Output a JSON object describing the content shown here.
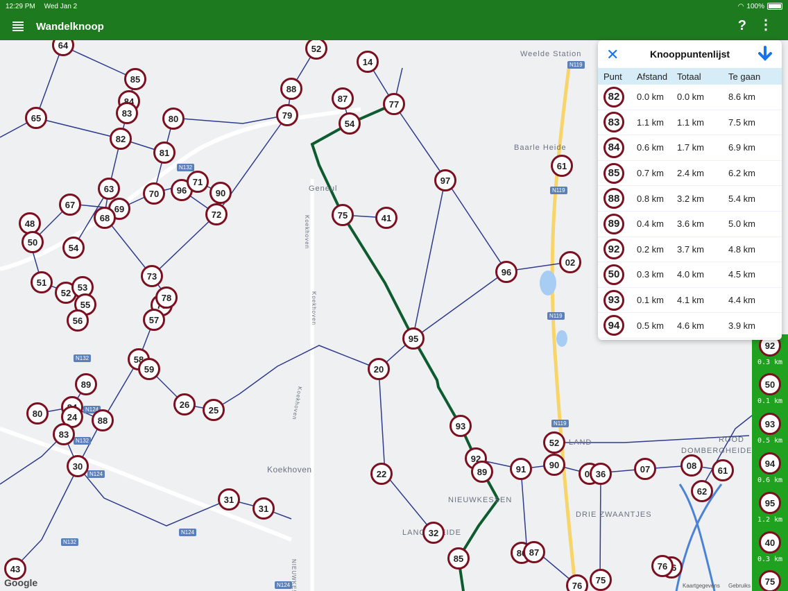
{
  "status": {
    "time": "12:29 PM",
    "date": "Wed Jan 2",
    "battery": "100%"
  },
  "app": {
    "title": "Wandelknoop",
    "help": "?",
    "more": "⋮"
  },
  "panel": {
    "title": "Knooppuntenlijst",
    "columns": [
      "Punt",
      "Afstand",
      "Totaal",
      "Te gaan"
    ],
    "rows": [
      {
        "punt": "82",
        "afstand": "0.0 km",
        "totaal": "0.0 km",
        "te_gaan": "8.6 km"
      },
      {
        "punt": "83",
        "afstand": "1.1 km",
        "totaal": "1.1 km",
        "te_gaan": "7.5 km"
      },
      {
        "punt": "84",
        "afstand": "0.6 km",
        "totaal": "1.7 km",
        "te_gaan": "6.9 km"
      },
      {
        "punt": "85",
        "afstand": "0.7 km",
        "totaal": "2.4 km",
        "te_gaan": "6.2 km"
      },
      {
        "punt": "88",
        "afstand": "0.8 km",
        "totaal": "3.2 km",
        "te_gaan": "5.4 km"
      },
      {
        "punt": "89",
        "afstand": "0.4 km",
        "totaal": "3.6 km",
        "te_gaan": "5.0 km"
      },
      {
        "punt": "92",
        "afstand": "0.2 km",
        "totaal": "3.7 km",
        "te_gaan": "4.8 km"
      },
      {
        "punt": "50",
        "afstand": "0.3 km",
        "totaal": "4.0 km",
        "te_gaan": "4.5 km"
      },
      {
        "punt": "93",
        "afstand": "0.1 km",
        "totaal": "4.1 km",
        "te_gaan": "4.4 km"
      },
      {
        "punt": "94",
        "afstand": "0.5 km",
        "totaal": "4.6 km",
        "te_gaan": "3.9 km"
      }
    ]
  },
  "strip": [
    {
      "node": "92",
      "dist": "0.3 km"
    },
    {
      "node": "50",
      "dist": "0.1 km"
    },
    {
      "node": "93",
      "dist": "0.5 km"
    },
    {
      "node": "94",
      "dist": "0.6 km"
    },
    {
      "node": "95",
      "dist": "1.2 km"
    },
    {
      "node": "40",
      "dist": "0.3 km"
    },
    {
      "node": "75",
      "dist": ""
    }
  ],
  "map": {
    "places": [
      "Weelde Station",
      "Baarle Heide",
      "Geneul",
      "Koekhoven",
      "Koekhoven",
      "Koekhoven",
      "Koekhoven",
      "NIEUWKESSEN",
      "LANGE HEIDE",
      "DRIE ZWAANTJES",
      "DOMBERGHEIDE",
      "ROOD",
      "LAND"
    ],
    "roads": [
      "N119",
      "N119",
      "N119",
      "N119",
      "N132",
      "N132",
      "N132",
      "N124",
      "N124",
      "N124",
      "N124",
      "N132",
      "N119"
    ],
    "attribution": [
      "Kaartgegevens",
      "Gebruiks"
    ],
    "google": "Google",
    "nodes": [
      "64",
      "52",
      "14",
      "85",
      "84",
      "83",
      "88",
      "87",
      "77",
      "65",
      "80",
      "79",
      "54",
      "82",
      "81",
      "61",
      "63",
      "96",
      "71",
      "90",
      "97",
      "67",
      "69",
      "68",
      "70",
      "72",
      "75",
      "41",
      "48",
      "50",
      "54",
      "73",
      "96",
      "02",
      "51",
      "52",
      "53",
      "55",
      "79",
      "78",
      "56",
      "57",
      "95",
      "58",
      "59",
      "20",
      "89",
      "84",
      "80",
      "24",
      "88",
      "26",
      "25",
      "83",
      "93",
      "52",
      "92",
      "89",
      "91",
      "90",
      "06",
      "36",
      "07",
      "08",
      "61",
      "62",
      "30",
      "22",
      "31",
      "31",
      "32",
      "85",
      "86",
      "87",
      "43",
      "76",
      "75",
      "66",
      "76"
    ],
    "accent": "#7a1020",
    "route_color": "#0d5b2e",
    "network_color": "#2e3a8c",
    "brand_green": "#1e7a1e"
  }
}
